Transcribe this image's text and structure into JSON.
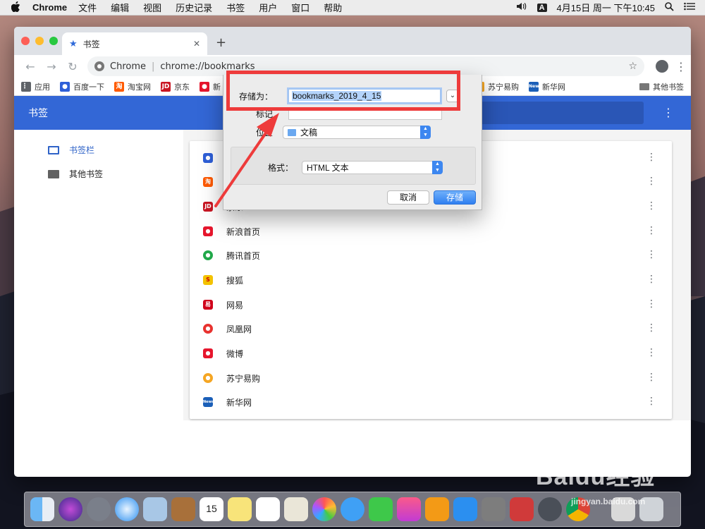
{
  "menubar": {
    "app_name": "Chrome",
    "menus": [
      "文件",
      "编辑",
      "视图",
      "历史记录",
      "书签",
      "用户",
      "窗口",
      "帮助"
    ],
    "input_method": "A",
    "clock": "4月15日 周一 下午10:45"
  },
  "browser": {
    "tab_title": "书签",
    "omnibox": {
      "origin": "Chrome",
      "url": "chrome://bookmarks"
    },
    "bookmarks_bar": {
      "items": [
        "应用",
        "百度一下",
        "淘宝网",
        "京东",
        "新",
        "苏宁易购",
        "新华网"
      ],
      "other": "其他书签"
    }
  },
  "bookmarks_page": {
    "header_title": "书签",
    "sidebar": [
      "书签栏",
      "其他书签"
    ],
    "rows": [
      {
        "name": ""
      },
      {
        "name": ""
      },
      {
        "name": "京东"
      },
      {
        "name": "新浪首页"
      },
      {
        "name": "腾讯首页"
      },
      {
        "name": "搜狐"
      },
      {
        "name": "网易"
      },
      {
        "name": "凤凰网"
      },
      {
        "name": "微博"
      },
      {
        "name": "苏宁易购"
      },
      {
        "name": "新华网"
      }
    ]
  },
  "save_dialog": {
    "save_as_label": "存储为：",
    "filename": "bookmarks_2019_4_15",
    "tags_label": "标记",
    "location_label": "位置",
    "location_value": "文稿",
    "format_label": "格式：",
    "format_value": "HTML 文本",
    "cancel_label": "取消",
    "save_label": "存储"
  },
  "watermark": {
    "brand": "Baidu经验",
    "site": "jingyan.baidu.com"
  },
  "colors": {
    "header_blue": "#3367d6",
    "annotation_red": "#ee3b3b",
    "save_button": "#2f7ff0"
  }
}
